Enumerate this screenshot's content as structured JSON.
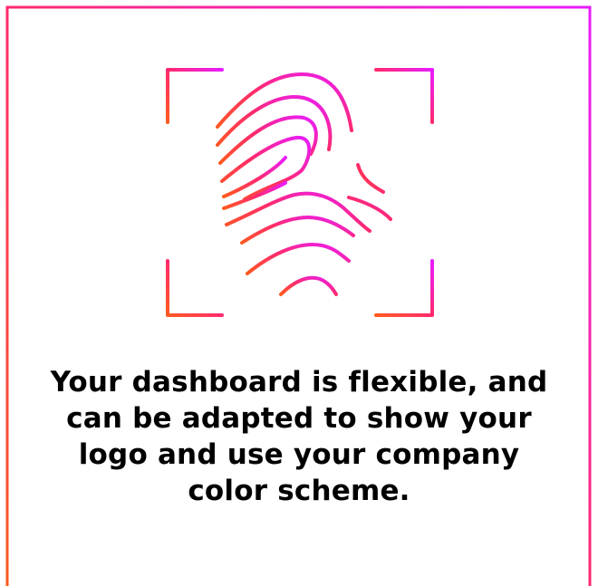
{
  "message": {
    "text": "Your dashboard is flexible, and can be adapted to show your logo and use your company color scheme."
  },
  "colors": {
    "gradient_start": "#ff5a1f",
    "gradient_mid": "#ff2a6d",
    "gradient_end": "#e81cff"
  },
  "illustration": {
    "icon": "fingerprint-scan-icon"
  }
}
